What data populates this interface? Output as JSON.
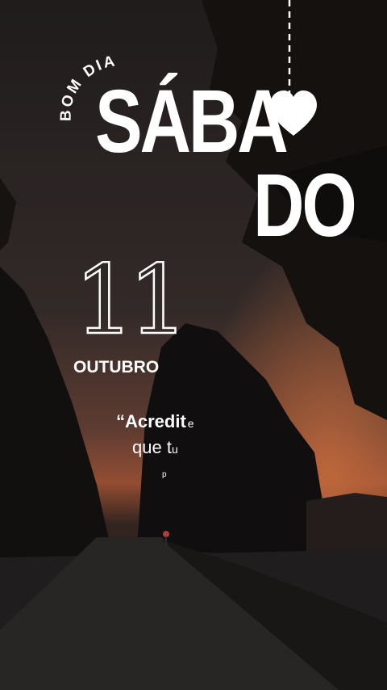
{
  "greeting": "BOM DIA",
  "weekday_part1": "SÁBA",
  "weekday_part2": "DO",
  "day_number": "11",
  "month": "OUTUBRO",
  "quote": {
    "line1_main": "“Acredit",
    "line1_tail": "e",
    "line2_main": "que t",
    "line2_tail": "u",
    "line3": "p"
  },
  "icons": {
    "heart": "heart-icon"
  },
  "colors": {
    "text": "#ffffff",
    "sky_dark": "#2b2424",
    "sunset": "#c0653a",
    "trees": "#141210",
    "road": "#2c2a2a"
  }
}
